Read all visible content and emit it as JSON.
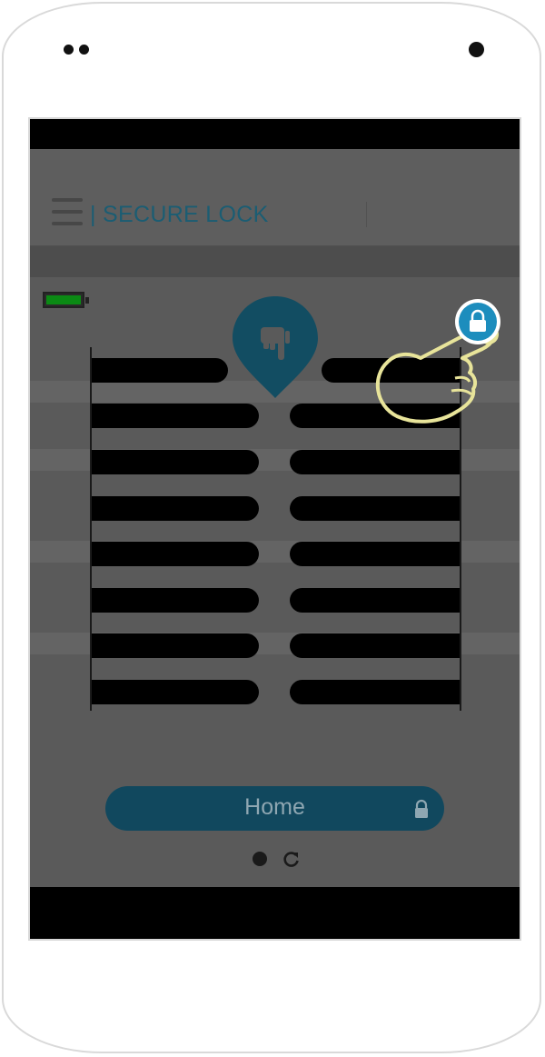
{
  "header": {
    "title": "| SECURE LOCK",
    "menu_icon": "hamburger-menu-icon"
  },
  "status": {
    "battery_icon": "battery-icon",
    "battery_level": 1.0,
    "battery_color": "#0b8a14"
  },
  "lock_pad": {
    "rows": 8,
    "pin_icon": "pointing-hand-icon",
    "corner_icon": "padlock-icon",
    "gesture_icon": "tap-gesture-hand-icon"
  },
  "footer": {
    "home_label": "Home",
    "home_icon": "padlock-icon",
    "page_dot_icon": "page-dot-icon",
    "refresh_icon": "refresh-icon"
  },
  "colors": {
    "accent": "#11485e",
    "title": "#1b5d73",
    "overlay": "#5a5a5a",
    "lock_badge": "#1c8dbd",
    "gesture_outline": "#e8e49a"
  }
}
